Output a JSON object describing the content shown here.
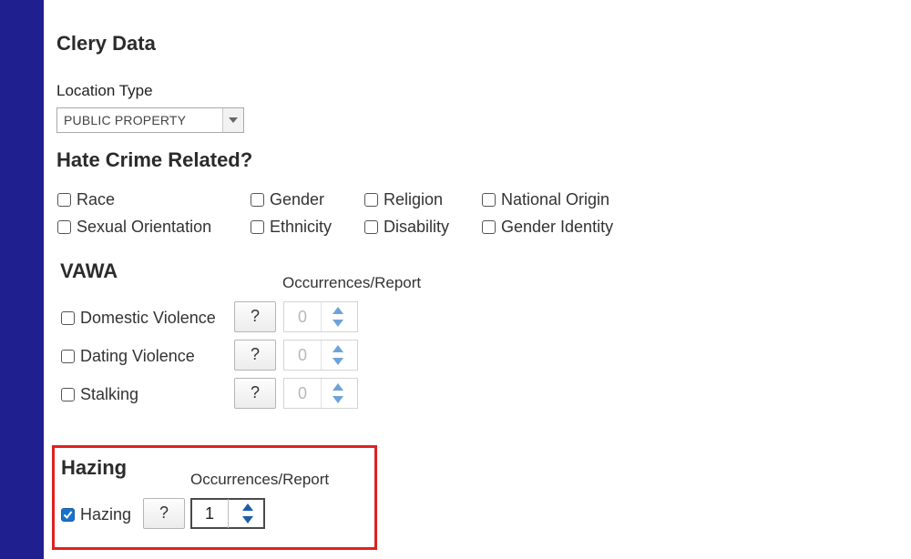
{
  "colors": {
    "sidebar": "#1f1f8f",
    "highlight": "#e02020",
    "checkbox_checked": "#1a73c8",
    "spinner_arrow": "#6ea3d8",
    "spinner_arrow_active": "#1a5fa8"
  },
  "clery": {
    "title": "Clery Data",
    "location_label": "Location Type",
    "location_value": "PUBLIC PROPERTY"
  },
  "hate": {
    "title": "Hate Crime Related?",
    "options": [
      {
        "label": "Race",
        "checked": false
      },
      {
        "label": "Gender",
        "checked": false
      },
      {
        "label": "Religion",
        "checked": false
      },
      {
        "label": "National Origin",
        "checked": false
      },
      {
        "label": "Sexual Orientation",
        "checked": false
      },
      {
        "label": "Ethnicity",
        "checked": false
      },
      {
        "label": "Disability",
        "checked": false
      },
      {
        "label": "Gender Identity",
        "checked": false
      }
    ]
  },
  "vawa": {
    "title": "VAWA",
    "occ_header": "Occurrences/Report",
    "rows": [
      {
        "label": "Domestic Violence",
        "help": "?",
        "count": "0",
        "checked": false
      },
      {
        "label": "Dating Violence",
        "help": "?",
        "count": "0",
        "checked": false
      },
      {
        "label": "Stalking",
        "help": "?",
        "count": "0",
        "checked": false
      }
    ]
  },
  "hazing": {
    "title": "Hazing",
    "occ_header": "Occurrences/Report",
    "row": {
      "label": "Hazing",
      "help": "?",
      "count": "1",
      "checked": true
    }
  }
}
